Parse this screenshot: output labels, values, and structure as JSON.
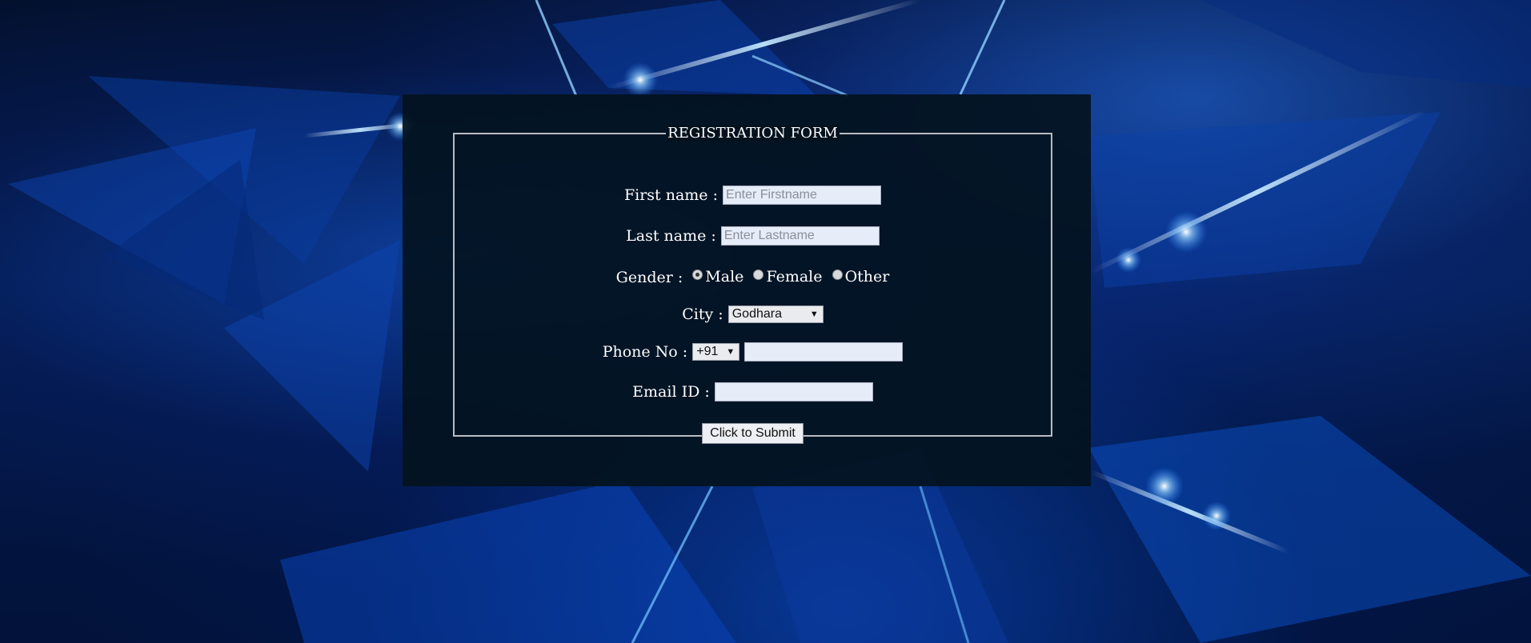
{
  "form": {
    "legend": "REGISTRATION FORM",
    "first_name": {
      "label": "First name :",
      "placeholder": "Enter Firstname",
      "value": ""
    },
    "last_name": {
      "label": "Last name :",
      "placeholder": "Enter Lastname",
      "value": ""
    },
    "gender": {
      "label": "Gender :",
      "options": [
        {
          "label": "Male",
          "checked": true
        },
        {
          "label": "Female",
          "checked": false
        },
        {
          "label": "Other",
          "checked": false
        }
      ]
    },
    "city": {
      "label": "City :",
      "selected": "Godhara"
    },
    "phone": {
      "label": "Phone No :",
      "country_code": "+91",
      "value": ""
    },
    "email": {
      "label": "Email ID :",
      "value": ""
    },
    "submit_label": "Click to Submit"
  },
  "icons": {
    "dropdown": "chevron-down-icon"
  },
  "colors": {
    "panel": "#03121e",
    "text": "#ffffff",
    "border": "#b9bcc2"
  }
}
